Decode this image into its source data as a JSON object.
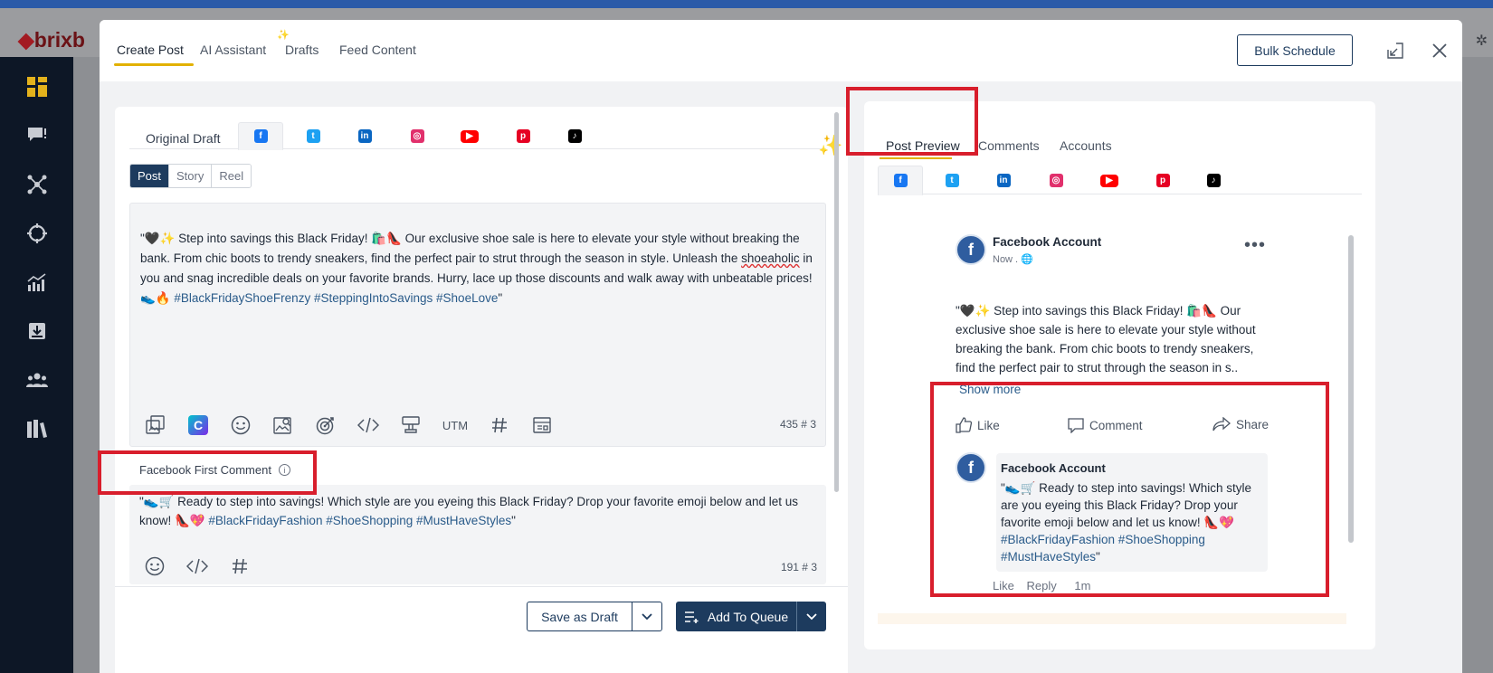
{
  "app": {
    "logo_text": "brixb"
  },
  "modal": {
    "tabs": [
      {
        "label": "Create Post",
        "active": true
      },
      {
        "label": "AI Assistant",
        "active": false
      },
      {
        "label": "Drafts",
        "active": false
      },
      {
        "label": "Feed Content",
        "active": false
      }
    ],
    "bulk_schedule_label": "Bulk Schedule",
    "icons": [
      "minimize-icon",
      "close-icon"
    ]
  },
  "editor": {
    "original_draft_label": "Original Draft",
    "networks": [
      {
        "name": "facebook",
        "glyph": "f",
        "color": "#1877f2"
      },
      {
        "name": "twitter",
        "glyph": "t",
        "color": "#1da1f2"
      },
      {
        "name": "linkedin",
        "glyph": "in",
        "color": "#0a66c2"
      },
      {
        "name": "instagram",
        "glyph": "◎",
        "color": "#e1306c"
      },
      {
        "name": "youtube",
        "glyph": "▶",
        "color": "#ff0000"
      },
      {
        "name": "pinterest",
        "glyph": "p",
        "color": "#e60023"
      },
      {
        "name": "tiktok",
        "glyph": "♪",
        "color": "#000000"
      }
    ],
    "post_types": [
      {
        "label": "Post",
        "active": true
      },
      {
        "label": "Story",
        "active": false
      },
      {
        "label": "Reel",
        "active": false
      }
    ],
    "post_text": {
      "part1": "\"🖤✨ Step into savings this Black Friday! 🛍️👠 Our exclusive shoe sale is here to elevate your style without breaking the bank. From chic boots to trendy sneakers, find the perfect pair to strut through the season in style. Unleash the ",
      "misspelled": "shoeaholic",
      "part2": " in you and snag incredible deals on your favorite brands. Hurry, lace up those discounts and walk away with unbeatable prices! 👟🔥 ",
      "hashtags": "#BlackFridayShoeFrenzy #SteppingIntoSavings #ShoeLove",
      "closing": "\""
    },
    "toolbar": [
      "media-library-icon",
      "canva-icon",
      "emoji-icon",
      "image-search-icon",
      "target-icon",
      "code-icon",
      "stamp-icon",
      "UTM",
      "hashtag-icon",
      "template-icon"
    ],
    "utm_label": "UTM",
    "char_count": "435",
    "hashtag_count": "3"
  },
  "first_comment": {
    "label": "Facebook First Comment",
    "text_main": "\"👟🛒 Ready to step into savings! Which style are you eyeing this Black Friday? Drop your favorite emoji below and let us know! 👠💖 ",
    "hashtags": "#BlackFridayFashion #ShoeShopping #MustHaveStyles",
    "closing": "\"",
    "char_count": "191",
    "hashtag_count": "3"
  },
  "footer": {
    "save_draft_label": "Save as Draft",
    "add_queue_label": "Add To Queue"
  },
  "preview": {
    "tabs": [
      {
        "label": "Post Preview",
        "active": true
      },
      {
        "label": "Comments",
        "active": false
      },
      {
        "label": "Accounts",
        "active": false
      }
    ],
    "account_name": "Facebook Account",
    "time": "Now .",
    "post_excerpt": "\"🖤✨ Step into savings this Black Friday! 🛍️👠 Our exclusive shoe sale is here to elevate your style without breaking the bank. From chic boots to trendy sneakers, find the perfect pair to strut through the season in s..",
    "show_more": "Show more",
    "actions": {
      "like": "Like",
      "comment": "Comment",
      "share": "Share"
    },
    "comment": {
      "author": "Facebook Account",
      "text_main": "\"👟🛒 Ready to step into savings! Which style are you eyeing this Black Friday? Drop your favorite emoji below and let us know! 👠💖 ",
      "hashtags": "#BlackFridayFashion #ShoeShopping #MustHaveStyles",
      "closing": "\"",
      "like": "Like",
      "reply": "Reply",
      "age": "1m"
    }
  },
  "colors": {
    "primary": "#1d3b5e",
    "accent_underline": "#e2b100",
    "highlight_red": "#d81e2c",
    "hashtag": "#2a5b8a"
  }
}
